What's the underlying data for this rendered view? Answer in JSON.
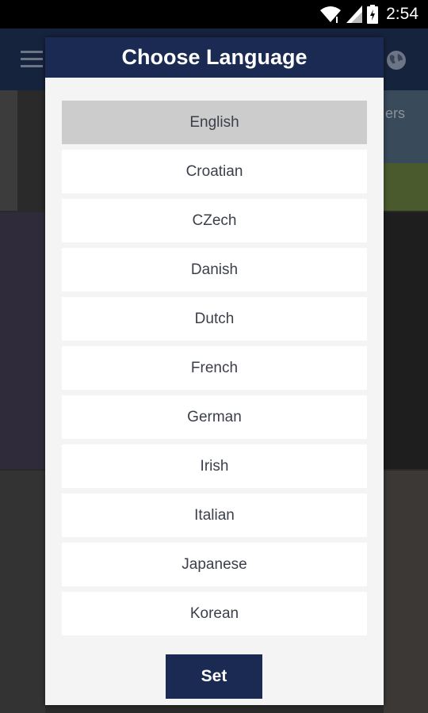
{
  "status_bar": {
    "time": "2:54",
    "icons": [
      "wifi-icon",
      "signal-icon",
      "battery-icon"
    ]
  },
  "app": {
    "toolbar_icons": [
      "menu-icon",
      "globe-icon"
    ],
    "background_tab_text": "ers"
  },
  "dialog": {
    "title": "Choose Language",
    "languages": [
      "English",
      "Croatian",
      "CZech",
      "Danish",
      "Dutch",
      "French",
      "German",
      "Irish",
      "Italian",
      "Japanese",
      "Korean"
    ],
    "selected": "English",
    "set_label": "Set"
  },
  "colors": {
    "header": "#1a2a52",
    "dialog_bg": "#f4f4f4",
    "selected_item": "#cccccc",
    "item_bg": "#ffffff"
  }
}
